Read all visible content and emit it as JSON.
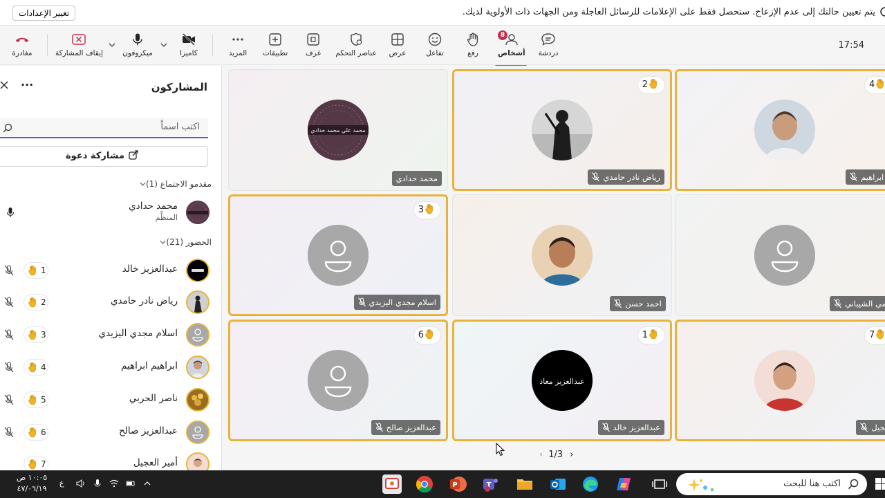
{
  "notification": {
    "text": "يتم تعيين حالتك إلى عدم الإزعاج. ستحصل فقط على الإعلامات للرسائل العاجلة ومن الجهات ذات الأولوية لديك.",
    "button": "تغيير الإعدادات"
  },
  "toolbar": {
    "time": "17:54",
    "chat": "دردشة",
    "people": "أشخاص",
    "people_count": "8",
    "raise": "رفع",
    "react": "تفاعل",
    "view": "عرض",
    "controls": "عناصر التحكم",
    "rooms": "غرف",
    "apps": "تطبيقات",
    "more": "المزيد",
    "camera": "كاميرا",
    "mic": "ميكروفون",
    "stop_share": "إيقاف المشاركة",
    "leave": "مغادرة"
  },
  "panel": {
    "title": "المشاركون",
    "search_placeholder": "اكتب اسماً",
    "invite": "مشاركة دعوة",
    "presenters_header": "مقدمو الاجتماع (1)",
    "attendees_header": "الحضور (21)",
    "organizer": {
      "name": "محمد حدادي",
      "role": "المنظِّم"
    },
    "attendees": [
      {
        "name": "عبدالعزيز خالد",
        "hand": "1"
      },
      {
        "name": "رياض نادر حامدي",
        "hand": "2"
      },
      {
        "name": "اسلام مجدي اليزيدي",
        "hand": "3"
      },
      {
        "name": "ابراهيم ابراهيم",
        "hand": "4"
      },
      {
        "name": "ناصر الحربي",
        "hand": "5"
      },
      {
        "name": "عبدالعزيز صالح",
        "hand": "6"
      },
      {
        "name": "أمير العجيل",
        "hand": "7"
      }
    ]
  },
  "stage": {
    "tiles": [
      {
        "name": "محمد حدادي",
        "hand": "",
        "avatar_text": "محمد علي محمد حدادي"
      },
      {
        "name": "رياض نادر حامدي",
        "hand": "2"
      },
      {
        "name": "ابراهيم ابراهيم",
        "hand": "4"
      },
      {
        "name": "اسلام مجدي اليزيدي",
        "hand": "3"
      },
      {
        "name": "احمد حسن",
        "hand": ""
      },
      {
        "name": "مالك رامي الشيباني",
        "hand": ""
      },
      {
        "name": "عبدالعزيز صالح",
        "hand": "6"
      },
      {
        "name": "عبدالعزيز خالد",
        "hand": "1",
        "avatar_text": "عبدالعزيز معاذ"
      },
      {
        "name": "أمير العجيل",
        "hand": "7"
      }
    ],
    "pager": "1/3"
  },
  "taskbar": {
    "search_placeholder": "اكتب هنا للبحث",
    "time": "١٠:٠٥ ص",
    "date": "٤٧/٠٦/١٩",
    "lang": "ع"
  },
  "colors": {
    "accent": "#5b5fc7",
    "raised_border": "#e8b33a",
    "leave_red": "#c4314b"
  }
}
